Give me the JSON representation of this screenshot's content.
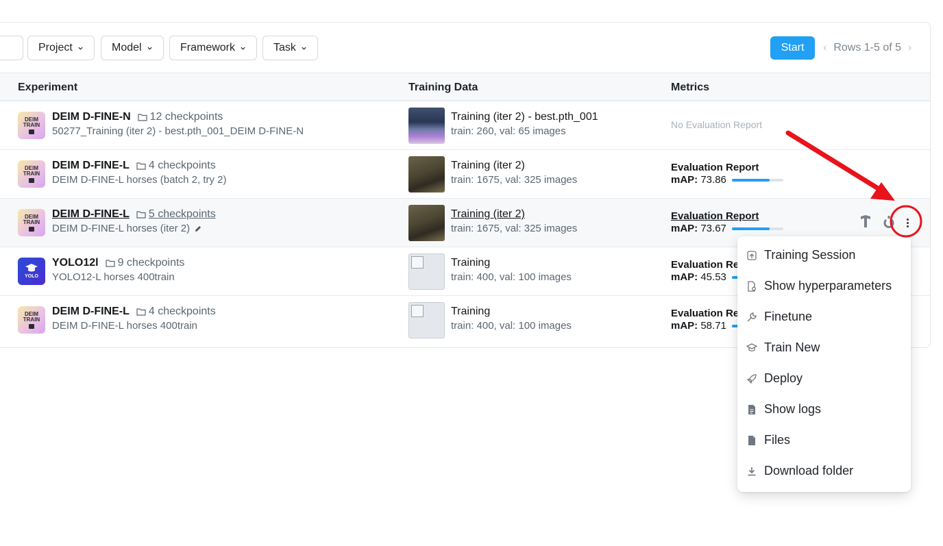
{
  "filters": [
    "Project",
    "Model",
    "Framework",
    "Task"
  ],
  "toolbar": {
    "start_label": "Start",
    "rows_label": "Rows 1-5 of 5"
  },
  "columns": {
    "experiment": "Experiment",
    "training_data": "Training Data",
    "metrics": "Metrics"
  },
  "rows": [
    {
      "logo": "DEIM TRAIN",
      "name": "DEIM D-FINE-N",
      "checkpoints": "12 checkpoints",
      "subtitle": "50277_Training (iter 2) - best.pth_001_DEIM D-FINE-N",
      "data_title": "Training (iter 2) - best.pth_001",
      "data_sub": "train: 260,  val: 65 images",
      "metric_none": "No Evaluation Report"
    },
    {
      "logo": "DEIM TRAIN",
      "name": "DEIM D-FINE-L",
      "checkpoints": "4 checkpoints",
      "subtitle": "DEIM D-FINE-L horses (batch 2, try 2)",
      "data_title": "Training (iter 2)",
      "data_sub": "train: 1675,  val: 325 images",
      "metric_title": "Evaluation Report",
      "map_label": "mAP:",
      "map_value": "73.86",
      "map_fraction": 0.7386
    },
    {
      "logo": "DEIM TRAIN",
      "name": "DEIM D-FINE-L",
      "checkpoints": "5 checkpoints",
      "subtitle": "DEIM D-FINE-L horses (iter 2)",
      "data_title": "Training (iter 2)",
      "data_sub": "train: 1675,  val: 325 images",
      "metric_title": "Evaluation Report",
      "map_label": "mAP:",
      "map_value": "73.67",
      "map_fraction": 0.7367
    },
    {
      "logo": "YOLO",
      "name": "YOLO12l",
      "checkpoints": "9 checkpoints",
      "subtitle": "YOLO12-L horses 400train",
      "data_title": "Training",
      "data_sub": "train: 400,  val: 100 images",
      "metric_title": "Evaluation Re",
      "map_label": "mAP:",
      "map_value": "45.53",
      "map_fraction": 0.4553
    },
    {
      "logo": "DEIM TRAIN",
      "name": "DEIM D-FINE-L",
      "checkpoints": "4 checkpoints",
      "subtitle": "DEIM D-FINE-L horses 400train",
      "data_title": "Training",
      "data_sub": "train: 400,  val: 100 images",
      "metric_title": "Evaluation Re",
      "map_label": "mAP:",
      "map_value": "58.71",
      "map_fraction": 0.5871
    }
  ],
  "menu": {
    "items": [
      {
        "label": "Training Session",
        "icon": "session-icon"
      },
      {
        "label": "Show hyperparameters",
        "icon": "file-gear-icon"
      },
      {
        "label": "Finetune",
        "icon": "wrench-icon"
      },
      {
        "label": "Train New",
        "icon": "graduation-cap-icon"
      },
      {
        "label": "Deploy",
        "icon": "rocket-icon"
      },
      {
        "label": "Show logs",
        "icon": "document-lines-icon"
      },
      {
        "label": "Files",
        "icon": "file-icon"
      },
      {
        "label": "Download folder",
        "icon": "download-icon"
      }
    ]
  },
  "colors": {
    "accent": "#21a0f5",
    "annotation": "#e8131b"
  }
}
